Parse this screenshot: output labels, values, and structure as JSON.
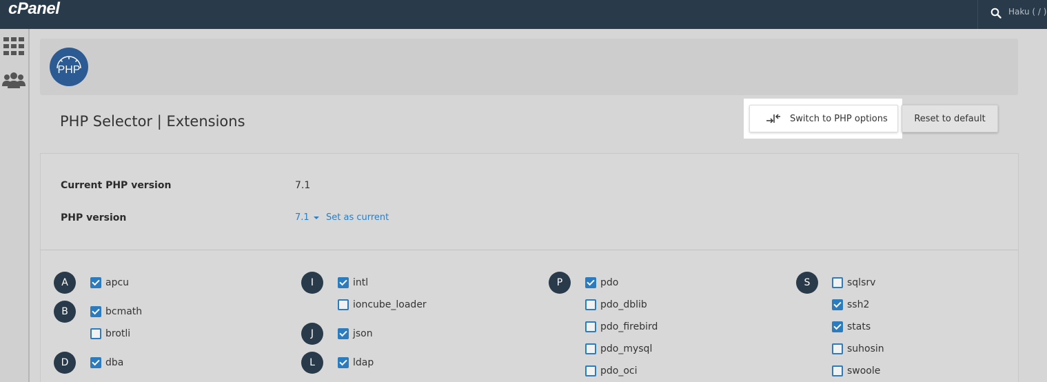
{
  "topbar": {
    "logo_text": "cPanel",
    "user_label": "Haku ( / )"
  },
  "page": {
    "title": "PHP Selector | Extensions"
  },
  "actions": {
    "switch_label": "Switch to PHP options",
    "reset_label": "Reset to default"
  },
  "info": {
    "current_label": "Current PHP version",
    "current_value": "7.1",
    "version_label": "PHP version",
    "version_selected": "7.1",
    "set_current_label": "Set as current"
  },
  "groups": [
    {
      "letter": "A",
      "extensions": [
        {
          "name": "apcu",
          "checked": true
        }
      ]
    },
    {
      "letter": "B",
      "extensions": [
        {
          "name": "bcmath",
          "checked": true
        },
        {
          "name": "brotli",
          "checked": false
        }
      ]
    },
    {
      "letter": "D",
      "extensions": [
        {
          "name": "dba",
          "checked": true
        }
      ]
    },
    {
      "letter": "I",
      "extensions": [
        {
          "name": "intl",
          "checked": true
        },
        {
          "name": "ioncube_loader",
          "checked": false
        }
      ]
    },
    {
      "letter": "J",
      "extensions": [
        {
          "name": "json",
          "checked": true
        }
      ]
    },
    {
      "letter": "L",
      "extensions": [
        {
          "name": "ldap",
          "checked": true
        }
      ]
    },
    {
      "letter": "P",
      "extensions": [
        {
          "name": "pdo",
          "checked": true
        },
        {
          "name": "pdo_dblib",
          "checked": false
        },
        {
          "name": "pdo_firebird",
          "checked": false
        },
        {
          "name": "pdo_mysql",
          "checked": false
        },
        {
          "name": "pdo_oci",
          "checked": false
        }
      ]
    },
    {
      "letter": "S",
      "extensions": [
        {
          "name": "sqlsrv",
          "checked": false
        },
        {
          "name": "ssh2",
          "checked": true
        },
        {
          "name": "stats",
          "checked": true
        },
        {
          "name": "suhosin",
          "checked": false
        },
        {
          "name": "swoole",
          "checked": false
        }
      ]
    }
  ],
  "colors": {
    "topbar": "#293a4a",
    "accent": "#2b7bbf",
    "link": "#2a7ec4"
  }
}
